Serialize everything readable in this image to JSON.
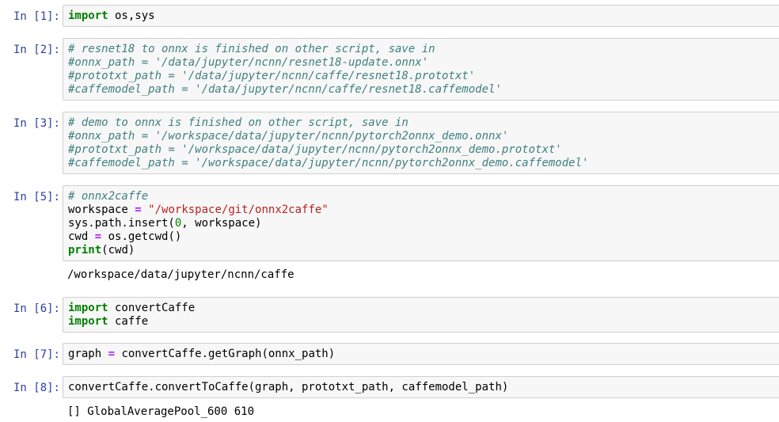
{
  "cells": [
    {
      "prompt": "In [1]:",
      "lines": [
        [
          {
            "t": "import",
            "c": "keyword"
          },
          {
            "t": " os,sys",
            "c": ""
          }
        ]
      ]
    },
    {
      "prompt": "In [2]:",
      "lines": [
        [
          {
            "t": "# resnet18 to onnx is finished on other script, save in",
            "c": "comment"
          }
        ],
        [
          {
            "t": "#onnx_path = '/data/jupyter/ncnn/resnet18-update.onnx'",
            "c": "comment"
          }
        ],
        [
          {
            "t": "#prototxt_path = '/data/jupyter/ncnn/caffe/resnet18.prototxt'",
            "c": "comment"
          }
        ],
        [
          {
            "t": "#caffemodel_path = '/data/jupyter/ncnn/caffe/resnet18.caffemodel'",
            "c": "comment"
          }
        ]
      ]
    },
    {
      "prompt": "In [3]:",
      "lines": [
        [
          {
            "t": "# demo to onnx is finished on other script, save in",
            "c": "comment"
          }
        ],
        [
          {
            "t": "#onnx_path = '/workspace/data/jupyter/ncnn/pytorch2onnx_demo.onnx'",
            "c": "comment"
          }
        ],
        [
          {
            "t": "#prototxt_path = '/workspace/data/jupyter/ncnn/pytorch2onnx_demo.prototxt'",
            "c": "comment"
          }
        ],
        [
          {
            "t": "#caffemodel_path = '/workspace/data/jupyter/ncnn/pytorch2onnx_demo.caffemodel'",
            "c": "comment"
          }
        ]
      ]
    },
    {
      "prompt": "In [5]:",
      "lines": [
        [
          {
            "t": "# onnx2caffe",
            "c": "comment"
          }
        ],
        [
          {
            "t": "workspace ",
            "c": ""
          },
          {
            "t": "=",
            "c": "operator"
          },
          {
            "t": " ",
            "c": ""
          },
          {
            "t": "\"/workspace/git/onnx2caffe\"",
            "c": "string"
          }
        ],
        [
          {
            "t": "sys.path.insert(",
            "c": ""
          },
          {
            "t": "0",
            "c": "number"
          },
          {
            "t": ", workspace)",
            "c": ""
          }
        ],
        [
          {
            "t": "cwd ",
            "c": ""
          },
          {
            "t": "=",
            "c": "operator"
          },
          {
            "t": " os.getcwd()",
            "c": ""
          }
        ],
        [
          {
            "t": "print",
            "c": "keyword"
          },
          {
            "t": "(cwd)",
            "c": ""
          }
        ]
      ],
      "output": [
        "/workspace/data/jupyter/ncnn/caffe"
      ]
    },
    {
      "prompt": "In [6]:",
      "lines": [
        [
          {
            "t": "import",
            "c": "keyword"
          },
          {
            "t": " convertCaffe",
            "c": ""
          }
        ],
        [
          {
            "t": "import",
            "c": "keyword"
          },
          {
            "t": " caffe",
            "c": ""
          }
        ]
      ]
    },
    {
      "prompt": "In [7]:",
      "lines": [
        [
          {
            "t": "graph ",
            "c": ""
          },
          {
            "t": "=",
            "c": "operator"
          },
          {
            "t": " convertCaffe.getGraph(onnx_path)",
            "c": ""
          }
        ]
      ]
    },
    {
      "prompt": "In [8]:",
      "lines": [
        [
          {
            "t": "convertCaffe.convertToCaffe(graph, prototxt_path, caffemodel_path)",
            "c": ""
          }
        ]
      ],
      "output": [
        "[] GlobalAveragePool_600 610"
      ]
    }
  ]
}
